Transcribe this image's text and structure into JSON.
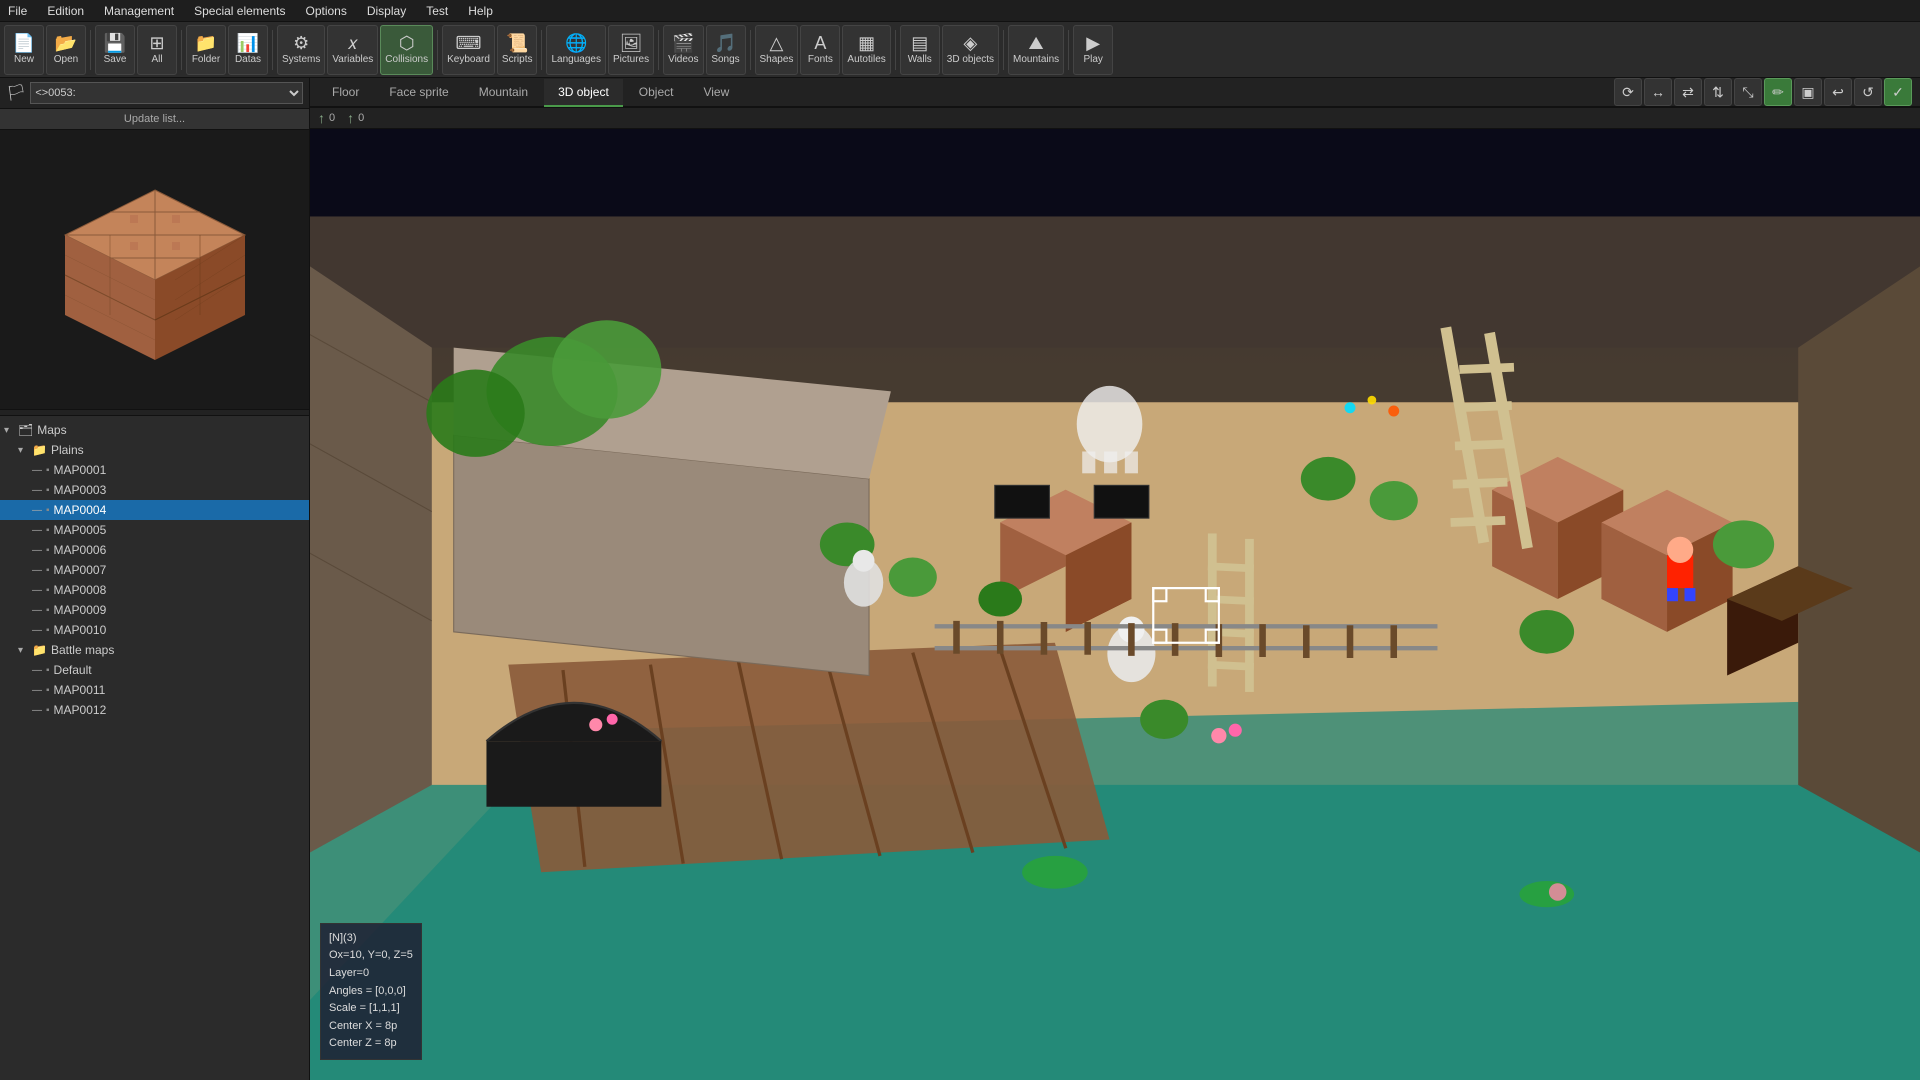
{
  "menubar": {
    "items": [
      "File",
      "Edition",
      "Management",
      "Special elements",
      "Options",
      "Display",
      "Test",
      "Help"
    ]
  },
  "toolbar": {
    "buttons": [
      {
        "id": "new",
        "label": "New",
        "icon": "📄"
      },
      {
        "id": "open",
        "label": "Open",
        "icon": "📂"
      },
      {
        "id": "save",
        "label": "Save",
        "icon": "💾"
      },
      {
        "id": "all",
        "label": "All",
        "icon": "⊞"
      },
      {
        "id": "folder",
        "label": "Folder",
        "icon": "📁"
      },
      {
        "id": "datas",
        "label": "Datas",
        "icon": "📊"
      },
      {
        "id": "systems",
        "label": "Systems",
        "icon": "⚙"
      },
      {
        "id": "variables",
        "label": "Variables",
        "icon": "𝑥"
      },
      {
        "id": "collisions",
        "label": "Collisions",
        "icon": "⬡"
      },
      {
        "id": "keyboard",
        "label": "Keyboard",
        "icon": "⌨"
      },
      {
        "id": "scripts",
        "label": "Scripts",
        "icon": "📜"
      },
      {
        "id": "languages",
        "label": "Languages",
        "icon": "🌐"
      },
      {
        "id": "pictures",
        "label": "Pictures",
        "icon": "🖼"
      },
      {
        "id": "videos",
        "label": "Videos",
        "icon": "🎬"
      },
      {
        "id": "songs",
        "label": "Songs",
        "icon": "🎵"
      },
      {
        "id": "shapes",
        "label": "Shapes",
        "icon": "△"
      },
      {
        "id": "fonts",
        "label": "Fonts",
        "icon": "A"
      },
      {
        "id": "autotiles",
        "label": "Autotiles",
        "icon": "▦"
      },
      {
        "id": "walls",
        "label": "Walls",
        "icon": "▤"
      },
      {
        "id": "3dobjects",
        "label": "3D objects",
        "icon": "◈"
      },
      {
        "id": "mountains",
        "label": "Mountains",
        "icon": "⛰"
      },
      {
        "id": "play",
        "label": "Play",
        "icon": "▶"
      }
    ]
  },
  "sidebar": {
    "map_selector_value": "<>0053:",
    "update_list_label": "Update list...",
    "tree": {
      "maps_label": "Maps",
      "plains_label": "Plains",
      "maps": [
        "MAP0001",
        "MAP0003",
        "MAP0004",
        "MAP0005",
        "MAP0006",
        "MAP0007",
        "MAP0008",
        "MAP0009",
        "MAP0010"
      ],
      "selected_map": "MAP0004",
      "battle_maps_label": "Battle maps",
      "default_label": "Default",
      "battle_maps": [
        "MAP0011",
        "MAP0012"
      ]
    }
  },
  "tabs": [
    "Floor",
    "Face sprite",
    "Mountain",
    "3D object",
    "Object",
    "View"
  ],
  "active_tab": "3D object",
  "coords": {
    "row1_arrow": "↑",
    "row1_value": "0",
    "row2_arrow": "↑",
    "row2_value": "0"
  },
  "view_buttons": [
    "⟳",
    "↔",
    "⇄",
    "⇅",
    "⤡",
    "✏",
    "▣",
    "↩",
    "↺",
    "✓"
  ],
  "info_overlay": {
    "line1": "[N](3)",
    "line2": "Ox=10, Y=0, Z=5",
    "line3": "Layer=0",
    "line4": "Angles = [0,0,0]",
    "line5": "Scale = [1,1,1]",
    "line6": "Center X = 8p",
    "line7": "Center Z = 8p"
  },
  "colors": {
    "selected_tab_border": "#4a9a4a",
    "selected_map_bg": "#1a6aa8",
    "toolbar_bg": "#2b2b2b",
    "menu_bg": "#1e1e1e",
    "sidebar_bg": "#2b2b2b",
    "content_bg": "#1a1a2a"
  }
}
